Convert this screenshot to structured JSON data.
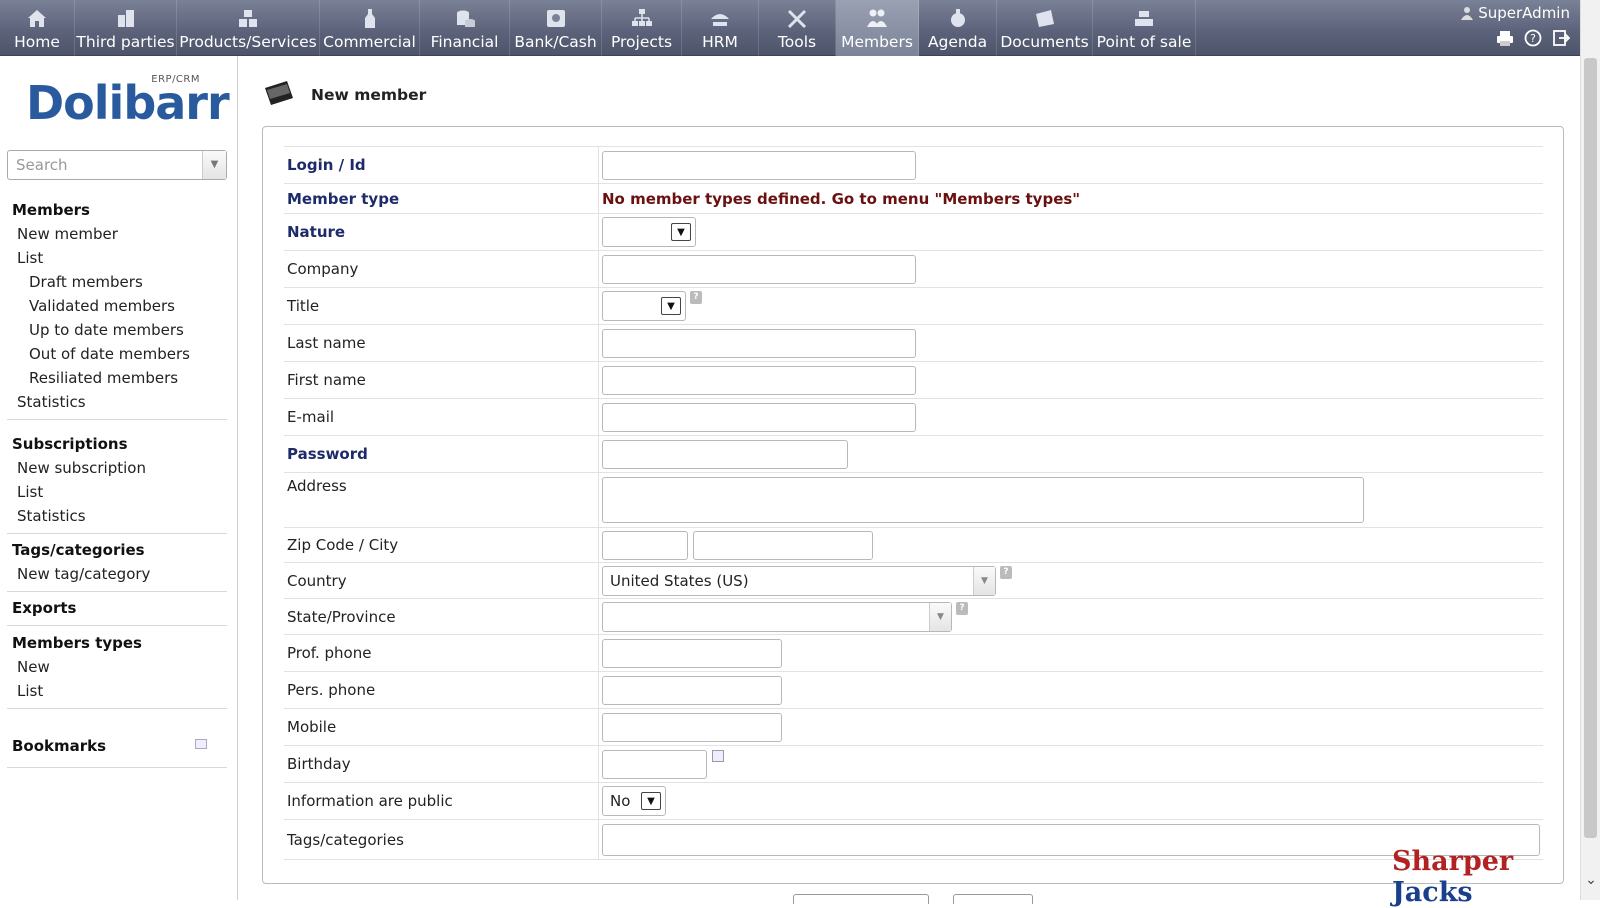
{
  "topmenu": {
    "items": [
      {
        "label": "Home",
        "icon": "home-icon"
      },
      {
        "label": "Third parties",
        "icon": "building-icon"
      },
      {
        "label": "Products/Services",
        "icon": "boxes-icon"
      },
      {
        "label": "Commercial",
        "icon": "bottle-icon"
      },
      {
        "label": "Financial",
        "icon": "coins-icon"
      },
      {
        "label": "Bank/Cash",
        "icon": "safe-icon"
      },
      {
        "label": "Projects",
        "icon": "hierarchy-icon"
      },
      {
        "label": "HRM",
        "icon": "hrm-icon"
      },
      {
        "label": "Tools",
        "icon": "tools-icon"
      },
      {
        "label": "Members",
        "icon": "members-icon"
      },
      {
        "label": "Agenda",
        "icon": "agenda-icon"
      },
      {
        "label": "Documents",
        "icon": "documents-icon"
      },
      {
        "label": "Point of sale",
        "icon": "cash-register-icon"
      }
    ],
    "active": "Members",
    "user": "SuperAdmin"
  },
  "logo": {
    "text": "Dolibarr",
    "sub": "ERP/CRM"
  },
  "search": {
    "placeholder": "Search"
  },
  "sidebar": {
    "members": {
      "title": "Members",
      "new_member": "New member",
      "list": "List",
      "draft": "Draft members",
      "validated": "Validated members",
      "uptodate": "Up to date members",
      "outofdate": "Out of date members",
      "resiliated": "Resiliated members",
      "statistics": "Statistics"
    },
    "subscriptions": {
      "title": "Subscriptions",
      "new_subscription": "New subscription",
      "list": "List",
      "statistics": "Statistics"
    },
    "tags": {
      "title": "Tags/categories",
      "new": "New tag/category"
    },
    "exports": {
      "title": "Exports"
    },
    "member_types": {
      "title": "Members types",
      "new": "New",
      "list": "List"
    },
    "bookmarks": {
      "title": "Bookmarks"
    }
  },
  "page": {
    "title": "New member"
  },
  "form": {
    "login_label": "Login / Id",
    "member_type_label": "Member type",
    "member_type_msg": "No member types defined. Go to menu \"Members types\"",
    "nature_label": "Nature",
    "company_label": "Company",
    "title_label": "Title",
    "lastname_label": "Last name",
    "firstname_label": "First name",
    "email_label": "E-mail",
    "password_label": "Password",
    "address_label": "Address",
    "zip_label": "Zip Code / City",
    "country_label": "Country",
    "country_value": "United States (US)",
    "state_label": "State/Province",
    "prof_phone_label": "Prof. phone",
    "pers_phone_label": "Pers. phone",
    "mobile_label": "Mobile",
    "birthday_label": "Birthday",
    "public_label": "Information are public",
    "public_value": "No",
    "tags_label": "Tags/categories"
  },
  "watermark": {
    "part1": "Sharper",
    "part2": "Jacks"
  }
}
